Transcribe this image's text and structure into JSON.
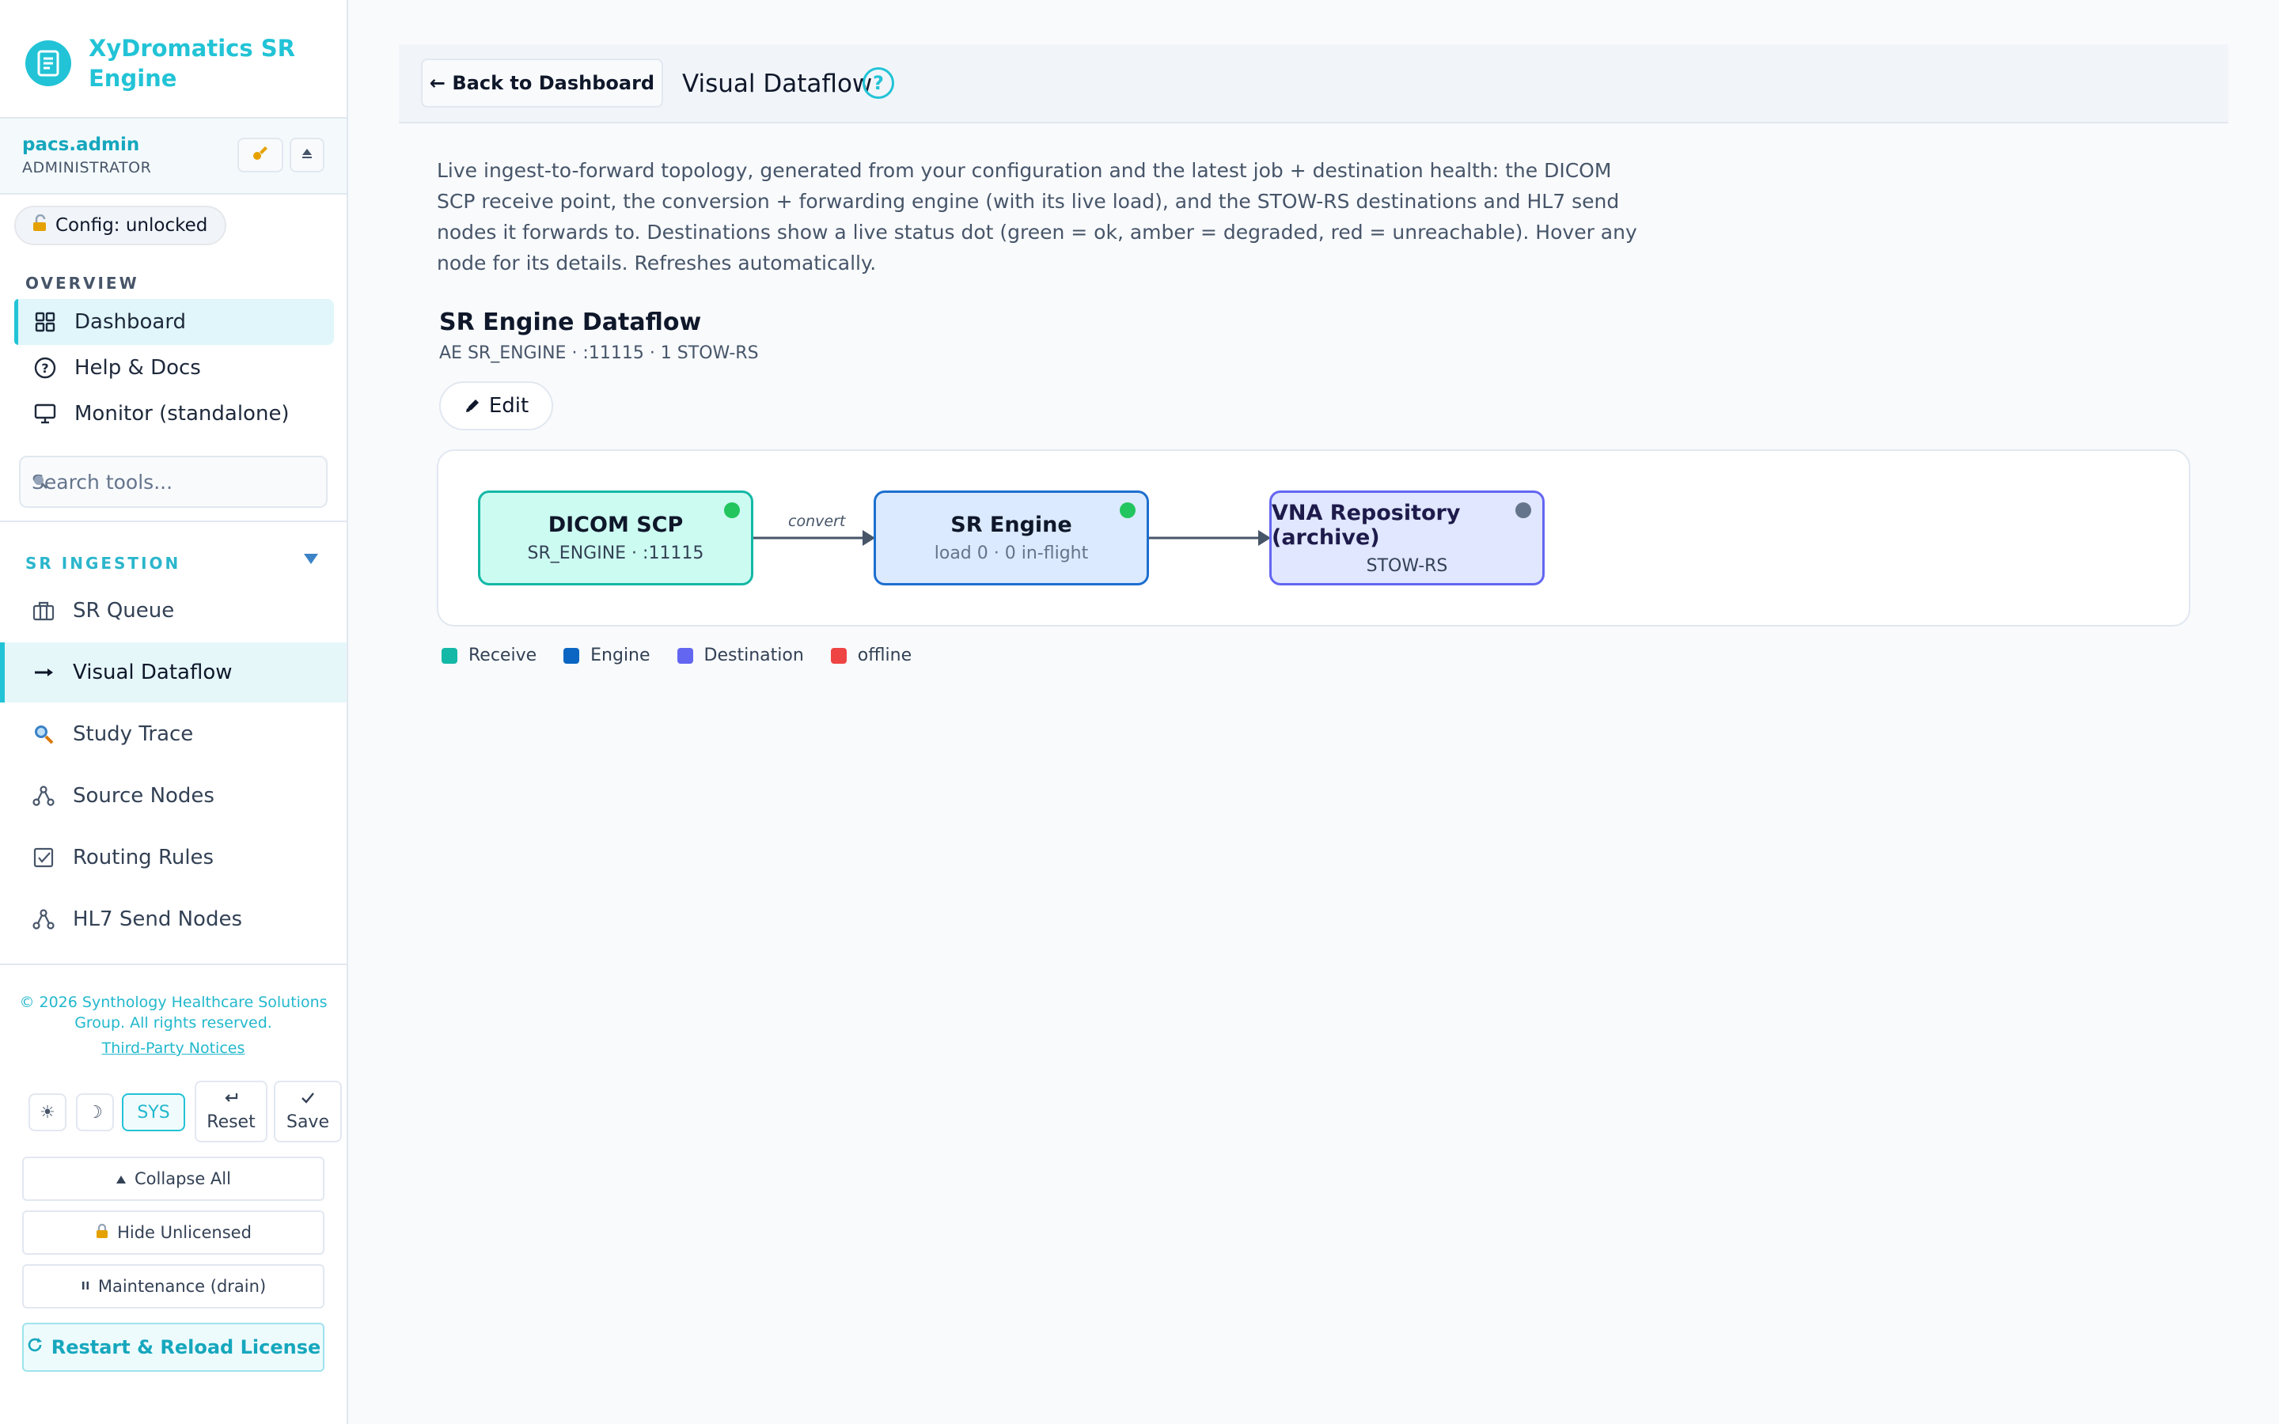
{
  "sidebar": {
    "brand": {
      "title": "XyDromatics SR Engine"
    },
    "user": {
      "name": "pacs.admin",
      "role": "ADMINISTRATOR"
    },
    "config_status": "Config: unlocked",
    "overview_label": "OVERVIEW",
    "overview_items": [
      {
        "label": "Dashboard",
        "icon": "grid-icon"
      },
      {
        "label": "Help & Docs",
        "icon": "help-circle-icon"
      },
      {
        "label": "Monitor (standalone)",
        "icon": "monitor-icon"
      }
    ],
    "search": {
      "placeholder": "Search tools...",
      "value": ""
    },
    "ingestion_label": "SR INGESTION",
    "ingestion_items": [
      {
        "label": "SR Queue",
        "icon": "briefcase-icon"
      },
      {
        "label": "Visual Dataflow",
        "icon": "arrow-right-icon"
      },
      {
        "label": "Study Trace",
        "icon": "magnifier-icon"
      },
      {
        "label": "Source Nodes",
        "icon": "network-icon"
      },
      {
        "label": "Routing Rules",
        "icon": "checkbox-icon"
      },
      {
        "label": "HL7 Send Nodes",
        "icon": "network-icon"
      }
    ],
    "footer": {
      "copyright": "© 2026 Synthology Healthcare Solutions Group. All rights reserved.",
      "notices_link": "Third-Party Notices"
    },
    "theme": {
      "light": "☀",
      "dark": "☽",
      "system": "SYS",
      "selected": "SYS"
    },
    "reset_label": "Reset",
    "save_label": "Save",
    "collapse_all": "Collapse All",
    "hide_unlicensed": "Hide Unlicensed",
    "maintenance": "Maintenance (drain)",
    "restart": "Restart & Reload License"
  },
  "main": {
    "back_button": "← Back to Dashboard",
    "title": "Visual Dataflow",
    "help_glyph": "?",
    "description": "Live ingest-to-forward topology, generated from your configuration and the latest job + destination health: the DICOM SCP receive point, the conversion + forwarding engine (with its live load), and the STOW-RS destinations and HL7 send nodes it forwards to. Destinations show a live status dot (green = ok, amber = degraded, red = unreachable). Hover any node for its details. Refreshes automatically.",
    "dataflow": {
      "title": "SR Engine Dataflow",
      "subtitle": "AE SR_ENGINE · :11115 · 1 STOW-RS",
      "edit_label": "Edit",
      "edge_label": "convert",
      "nodes": [
        {
          "title": "DICOM SCP",
          "sub": "SR_ENGINE · :11115",
          "status": "ok",
          "status_color": "#22c55e"
        },
        {
          "title": "SR Engine",
          "sub": "load 0 · 0 in-flight",
          "status": "ok",
          "status_color": "#22c55e"
        },
        {
          "title": "VNA Repository (archive)",
          "sub": "STOW-RS",
          "status": "unknown",
          "status_color": "#64748b"
        }
      ],
      "legend": [
        {
          "label": "Receive",
          "color": "#14b8a6"
        },
        {
          "label": "Engine",
          "color": "#0a66c2"
        },
        {
          "label": "Destination",
          "color": "#6366f1"
        },
        {
          "label": "offline",
          "color": "#ef4444"
        }
      ]
    }
  },
  "colors": {
    "accent": "#22c3d6"
  }
}
